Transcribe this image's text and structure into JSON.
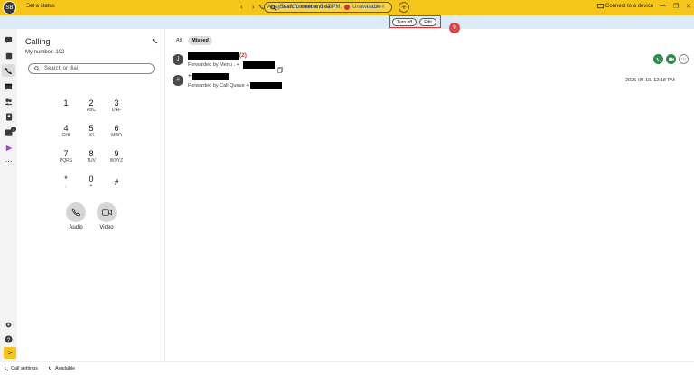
{
  "topbar": {
    "avatar_initials": "SB",
    "set_status": "Set a status",
    "back_arrow": "‹",
    "forward_arrow": "›",
    "search_placeholder": "Search, meet and call",
    "search_shortcut": "Ctrl+K",
    "add_symbol": "+",
    "connect_device": "Connect to a device",
    "minimize": "—",
    "restore": "❐",
    "close": "✕"
  },
  "banner": {
    "away_text": "Away until Tomorrow, 3:47 PM,",
    "status": "Unavailable",
    "turn_off_label": "Turn off",
    "edit_label": "Edit",
    "step_number": "9"
  },
  "rail": {
    "icons": [
      "messaging-icon",
      "teams-icon",
      "calling-icon",
      "meetings-icon",
      "contacts-icon",
      "directory-icon",
      "voicemail-icon",
      "apps-icon",
      "more-icon"
    ],
    "voicemail_badge": "1",
    "go_symbol": ">"
  },
  "calling": {
    "title": "Calling",
    "my_number": "My number: 102",
    "search_placeholder": "Search or dial",
    "keys": [
      {
        "digit": "1",
        "letters": ""
      },
      {
        "digit": "2",
        "letters": "ABC"
      },
      {
        "digit": "3",
        "letters": "DEF"
      },
      {
        "digit": "4",
        "letters": "GHI"
      },
      {
        "digit": "5",
        "letters": "JKL"
      },
      {
        "digit": "6",
        "letters": "MNO"
      },
      {
        "digit": "7",
        "letters": "PQRS"
      },
      {
        "digit": "8",
        "letters": "TUV"
      },
      {
        "digit": "9",
        "letters": "WXYZ"
      },
      {
        "digit": "*",
        "letters": ","
      },
      {
        "digit": "0",
        "letters": "+"
      },
      {
        "digit": "#",
        "letters": ""
      }
    ],
    "audio_label": "Audio",
    "video_label": "Video"
  },
  "bottom": {
    "call_settings": "Call settings",
    "available": "Available"
  },
  "history": {
    "tabs": [
      {
        "label": "All",
        "active": false
      },
      {
        "label": "Missed",
        "active": true
      }
    ],
    "entries": [
      {
        "initial": "J",
        "count": "(2)",
        "forwarded_by": "Forwarded by Menu . +",
        "time": ""
      },
      {
        "initial": "#",
        "prefix": "+",
        "forwarded_by": "Forwarded by Call Queue +",
        "time": "2025-09-10, 12:18 PM"
      }
    ]
  },
  "colors": {
    "brand_yellow": "#f5c518",
    "banner_blue": "#dcebf7",
    "unavailable_red": "#d32f2f",
    "call_green": "#2e8b4a"
  }
}
